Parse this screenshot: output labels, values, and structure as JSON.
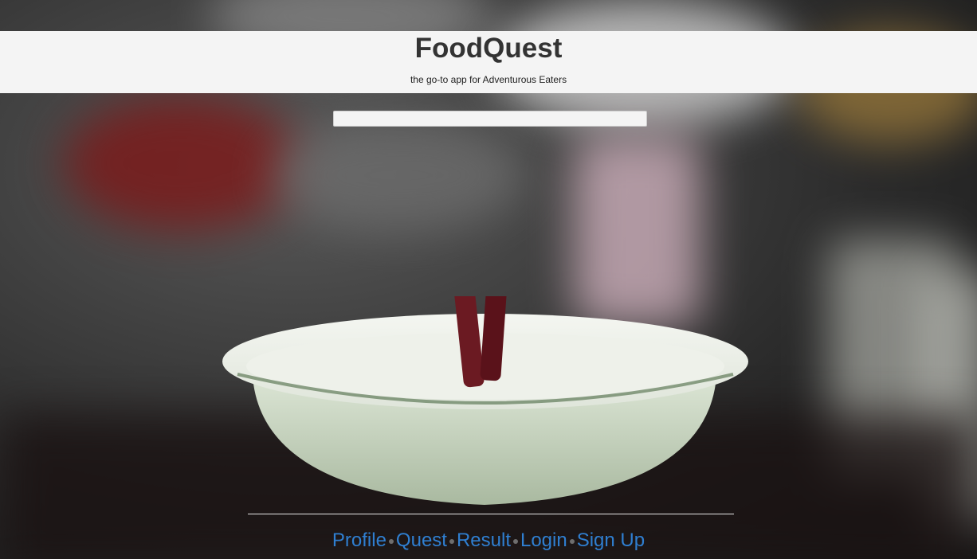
{
  "header": {
    "title": "FoodQuest",
    "tagline": "the go-to app for Adventurous Eaters"
  },
  "search": {
    "value": "",
    "placeholder": ""
  },
  "nav": {
    "items": [
      {
        "label": "Profile"
      },
      {
        "label": "Quest"
      },
      {
        "label": "Result"
      },
      {
        "label": "Login"
      },
      {
        "label": "Sign Up"
      }
    ]
  },
  "colors": {
    "header_bg": "#f4f4f4",
    "title": "#333333",
    "link": "#2f7fd1"
  },
  "background": {
    "icon": "bowl-with-chopsticks-photo"
  }
}
